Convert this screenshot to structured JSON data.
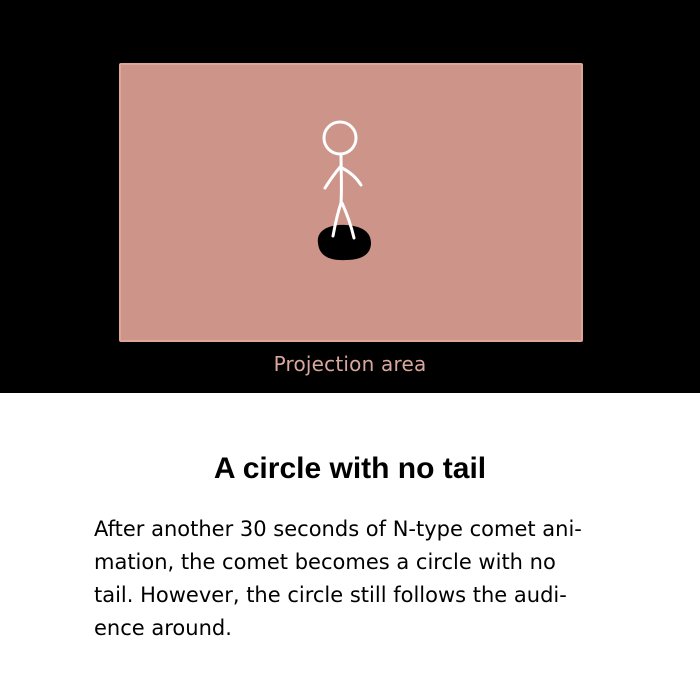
{
  "projection": {
    "label": "Projection area",
    "colors": {
      "background": "#000000",
      "area_fill": "#cd948a",
      "area_border": "#dea598",
      "label": "#d9a89c",
      "stick_figure": "#ffffff",
      "comet": "#000000"
    },
    "icons": [
      "stick-figure-icon",
      "comet-circle-icon"
    ]
  },
  "caption": {
    "title": "A circle with no tail",
    "lines": [
      "After another 30 seconds of N-type comet ani-",
      "mation, the comet becomes a circle with no",
      "tail. However, the circle still follows the audi-",
      "ence around."
    ]
  }
}
